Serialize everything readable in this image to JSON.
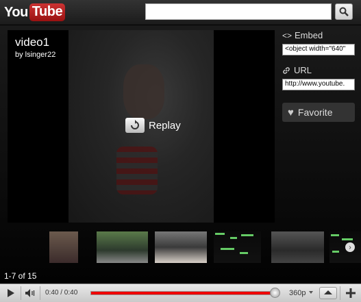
{
  "header": {
    "logo_you": "You",
    "logo_tube": "Tube",
    "search_placeholder": ""
  },
  "video": {
    "title": "video1",
    "author": "by lsinger22",
    "replay_label": "Replay"
  },
  "side": {
    "embed_label": "Embed",
    "embed_value": "<object width=\"640\"",
    "url_label": "URL",
    "url_value": "http://www.youtube.",
    "favorite_label": "Favorite"
  },
  "related": {
    "counter": "1-7 of 15",
    "thumbnails": [
      "thumb-1",
      "thumb-2",
      "thumb-3",
      "thumb-4",
      "thumb-5",
      "thumb-6"
    ]
  },
  "controls": {
    "time_current": "0:40",
    "time_total": "0:40",
    "time_display": "0:40 / 0:40",
    "quality": "360p",
    "progress": 1.0
  },
  "colors": {
    "accent": "#e00000",
    "logo_red": "#c33333"
  }
}
